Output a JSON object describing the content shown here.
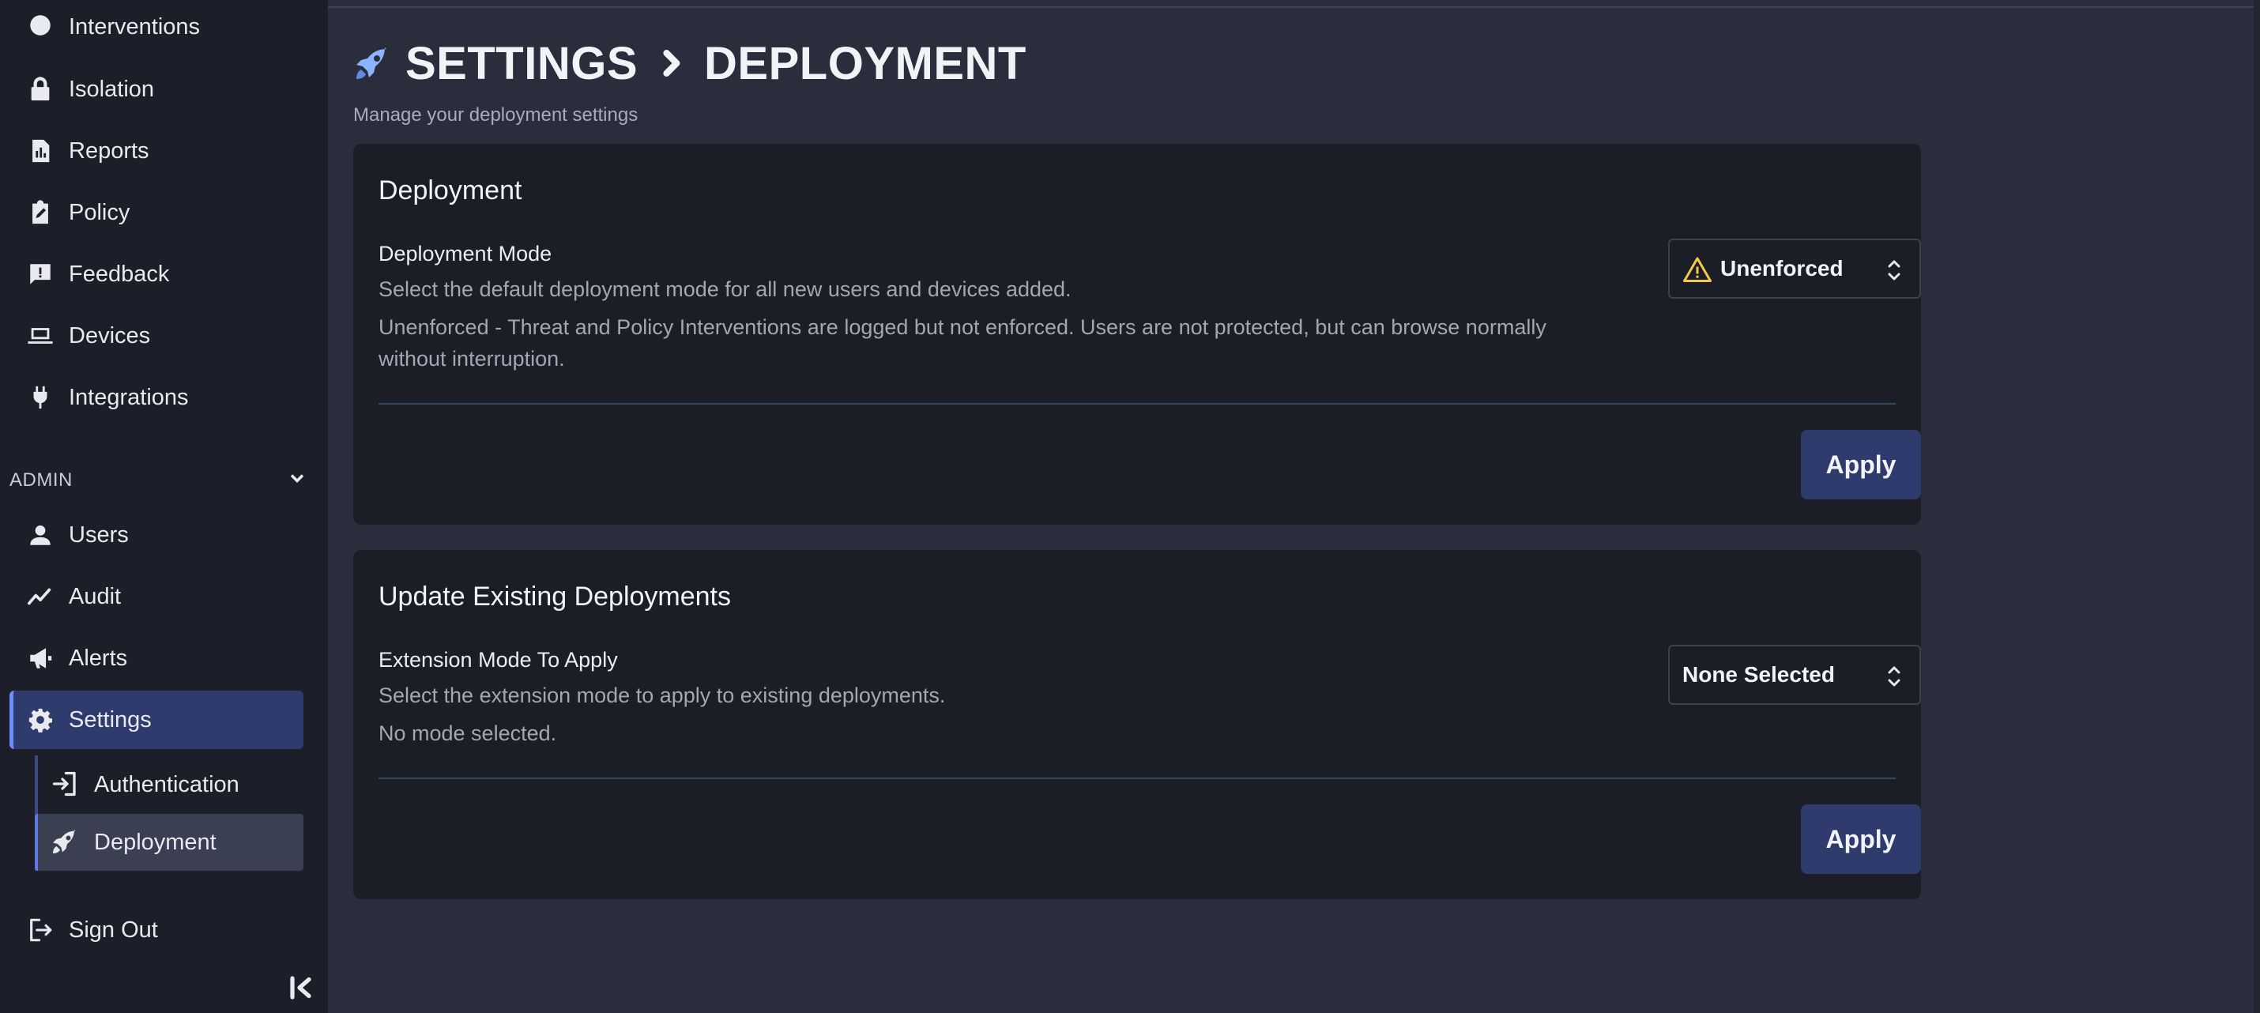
{
  "sidebar": {
    "top_items": [
      {
        "label": "Interventions",
        "icon": "interventions-icon"
      },
      {
        "label": "Isolation",
        "icon": "lock-icon"
      },
      {
        "label": "Reports",
        "icon": "reports-icon"
      },
      {
        "label": "Policy",
        "icon": "policy-icon"
      },
      {
        "label": "Feedback",
        "icon": "feedback-icon"
      },
      {
        "label": "Devices",
        "icon": "laptop-icon"
      },
      {
        "label": "Integrations",
        "icon": "plug-icon"
      }
    ],
    "admin_header": "ADMIN",
    "admin_items": [
      {
        "label": "Users",
        "icon": "user-icon"
      },
      {
        "label": "Audit",
        "icon": "trend-icon"
      },
      {
        "label": "Alerts",
        "icon": "megaphone-icon"
      },
      {
        "label": "Settings",
        "icon": "gear-icon"
      }
    ],
    "settings_sub_items": [
      {
        "label": "Authentication",
        "icon": "sign-in-icon"
      },
      {
        "label": "Deployment",
        "icon": "rocket-icon"
      }
    ],
    "sign_out": "Sign Out",
    "accent_color": "#2f3b6c"
  },
  "header": {
    "breadcrumb": [
      "SETTINGS",
      "DEPLOYMENT"
    ],
    "subtitle": "Manage your deployment settings"
  },
  "deployment_card": {
    "title": "Deployment",
    "field_label": "Deployment Mode",
    "description": "Select the default deployment mode for all new users and devices added.",
    "mode_description": "Unenforced - Threat and Policy Interventions are logged but not enforced. Users are not protected, but can browse normally without interruption.",
    "selected_mode": "Unenforced",
    "warning_color": "#f2c94c",
    "apply_label": "Apply"
  },
  "existing_card": {
    "title": "Update Existing Deployments",
    "field_label": "Extension Mode To Apply",
    "description": "Select the extension mode to apply to existing deployments.",
    "mode_description": "No mode selected.",
    "selected_mode": "None Selected",
    "apply_label": "Apply"
  }
}
